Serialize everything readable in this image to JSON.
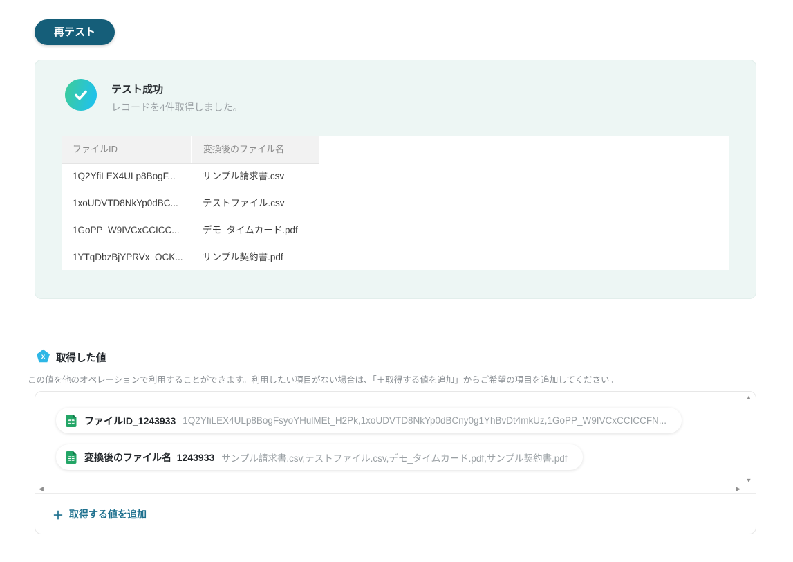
{
  "retest_button": {
    "label": "再テスト"
  },
  "success_panel": {
    "title": "テスト成功",
    "subtitle": "レコードを4件取得しました。",
    "table": {
      "columns": [
        "ファイルID",
        "変換後のファイル名"
      ],
      "rows": [
        [
          "1Q2YfiLEX4ULp8BogF...",
          "サンプル請求書.csv"
        ],
        [
          "1xoUDVTD8NkYp0dBC...",
          "テストファイル.csv"
        ],
        [
          "1GoPP_W9IVCxCCICC...",
          "デモ_タイムカード.pdf"
        ],
        [
          "1YTqDbzBjYPRVx_OCK...",
          "サンプル契約書.pdf"
        ]
      ]
    }
  },
  "values_section": {
    "title": "取得した値",
    "description": "この値を他のオペレーションで利用することができます。利用したい項目がない場合は、「＋取得する値を追加」からご希望の項目を追加してください。",
    "items": [
      {
        "label": "ファイルID_1243933",
        "value": "1Q2YfiLEX4ULp8BogFsyoYHulMEt_H2Pk,1xoUDVTD8NkYp0dBCny0g1YhBvDt4mkUz,1GoPP_W9IVCxCCICCFN..."
      },
      {
        "label": "変換後のファイル名_1243933",
        "value": "サンプル請求書.csv,テストファイル.csv,デモ_タイムカード.pdf,サンプル契約書.pdf"
      }
    ],
    "add_plus": "＋",
    "add_label": "取得する値を追加"
  },
  "icons": {
    "up": "▲",
    "down": "▼",
    "left": "◀",
    "right": "▶"
  },
  "colors": {
    "button_teal": "#155e79",
    "link_teal": "#1f718f",
    "success_bg": "#edf6f4",
    "check_gradient_start": "#3acba0",
    "check_gradient_end": "#22c2e8",
    "pentagon_cyan": "#2eb7e6",
    "sheets_green": "#23a566"
  }
}
